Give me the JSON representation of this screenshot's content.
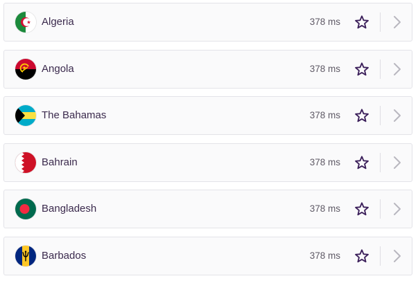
{
  "servers": [
    {
      "name": "Algeria",
      "latency": "378 ms",
      "flag_icon": "algeria-flag-icon"
    },
    {
      "name": "Angola",
      "latency": "378 ms",
      "flag_icon": "angola-flag-icon"
    },
    {
      "name": "The Bahamas",
      "latency": "378 ms",
      "flag_icon": "bahamas-flag-icon"
    },
    {
      "name": "Bahrain",
      "latency": "378 ms",
      "flag_icon": "bahrain-flag-icon"
    },
    {
      "name": "Bangladesh",
      "latency": "378 ms",
      "flag_icon": "bangladesh-flag-icon"
    },
    {
      "name": "Barbados",
      "latency": "378 ms",
      "flag_icon": "barbados-flag-icon"
    }
  ],
  "icons": {
    "favorite": "star-outline-icon",
    "open": "chevron-right-icon"
  },
  "colors": {
    "text": "#3b2a4d",
    "latency_text": "#5f5a66",
    "star": "#3b1f5a",
    "chevron": "#b9b7bf",
    "row_background": "#fafafb",
    "row_border": "#e3e3e8"
  }
}
